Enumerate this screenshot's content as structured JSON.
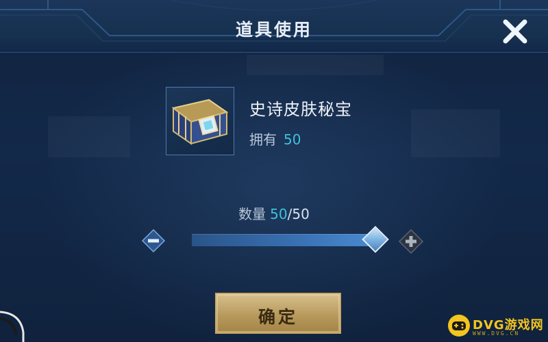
{
  "dialog": {
    "title": "道具使用",
    "close_icon": "close-icon"
  },
  "item": {
    "name": "史诗皮肤秘宝",
    "owned_label": "拥有",
    "owned_count": "50",
    "icon": "treasure-chest-icon"
  },
  "quantity": {
    "label": "数量",
    "current": "50",
    "separator": "/",
    "max": "50",
    "slider_fraction": 1.0
  },
  "confirm": {
    "label": "确定"
  },
  "watermark": {
    "text": "DVG游戏网",
    "subtext": "WWW.DVG.CN"
  },
  "colors": {
    "accent_cyan": "#3fc1dc",
    "gold_button": "#c9a763",
    "panel_blue": "#13294a"
  }
}
